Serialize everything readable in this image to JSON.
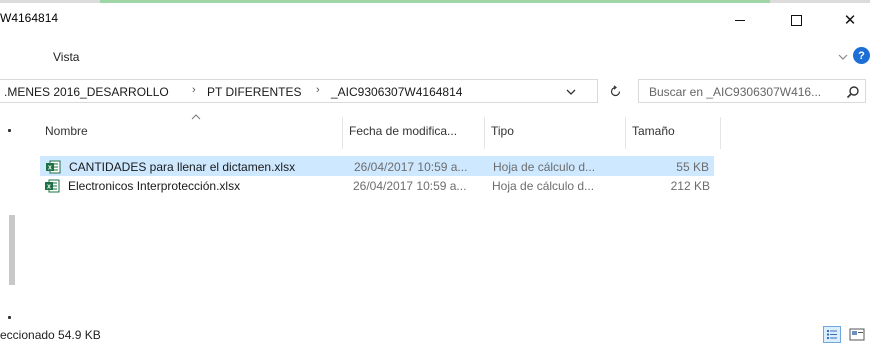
{
  "window": {
    "title": "W4164814",
    "minimize_label": "Minimize",
    "maximize_label": "Maximize",
    "close_label": "Close",
    "close_glyph": "✕"
  },
  "ribbon": {
    "tab_label": "Vista",
    "help_glyph": "?"
  },
  "address_bar": {
    "crumbs": [
      ".MENES 2016_DESARROLLO",
      "PT DIFERENTES",
      "_AIC9306307W4164814"
    ],
    "separator": "›"
  },
  "search": {
    "placeholder": "Buscar en _AIC9306307W416..."
  },
  "columns": {
    "name": "Nombre",
    "date": "Fecha de modifica...",
    "type": "Tipo",
    "size": "Tamaño"
  },
  "files": [
    {
      "name": "CANTIDADES para llenar el dictamen.xlsx",
      "date": "26/04/2017 10:59 a...",
      "type": "Hoja de cálculo d...",
      "size": "55 KB",
      "selected": true
    },
    {
      "name": "Electronicos Interprotección.xlsx",
      "date": "26/04/2017 10:59 a...",
      "type": "Hoja de cálculo d...",
      "size": "212 KB",
      "selected": false
    }
  ],
  "status_bar": {
    "text": "eccionado  54.9 KB"
  },
  "colors": {
    "accent_green": "#9fd6a7",
    "selection": "#cde8ff",
    "excel_green": "#1e7145",
    "help_blue": "#1d6fd6"
  }
}
